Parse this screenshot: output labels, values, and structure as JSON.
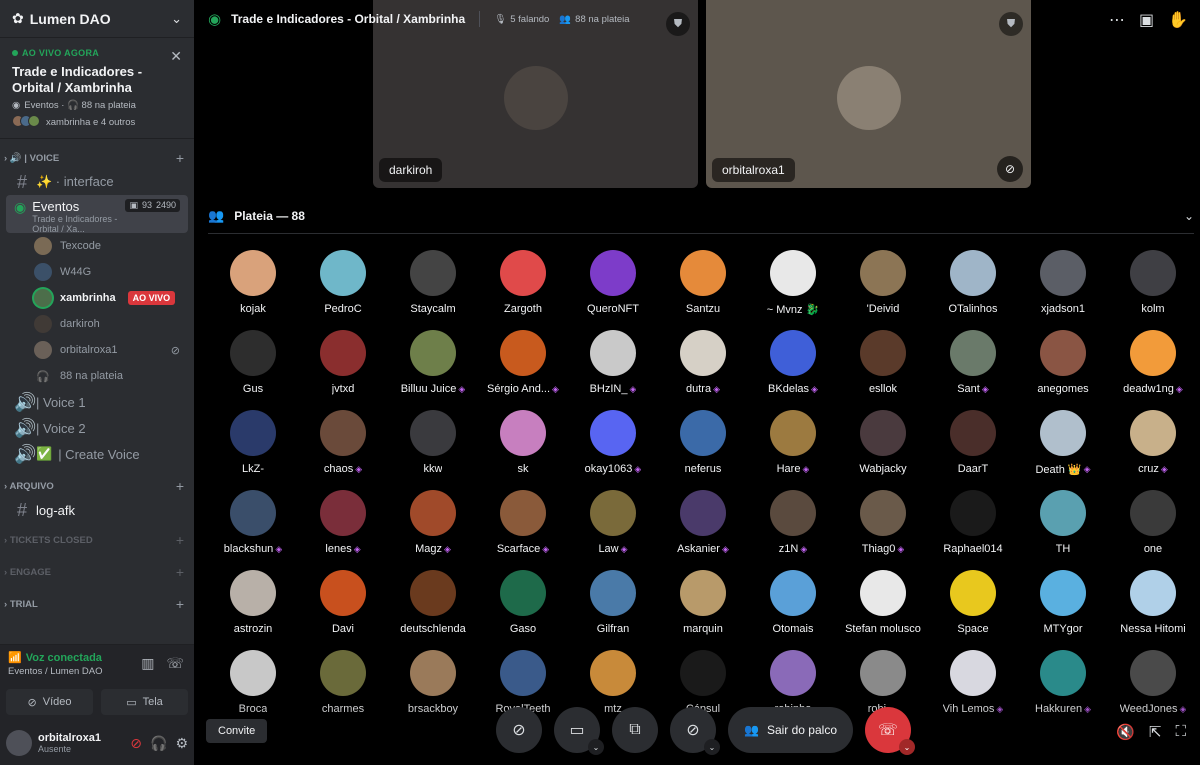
{
  "guild": {
    "name": "Lumen DAO"
  },
  "live": {
    "label": "AO VIVO AGORA",
    "title": "Trade e Indicadores - Orbital / Xambrinha",
    "meta": "Eventos · 🎧 88 na plateia",
    "participants": "xambrinha e 4 outros"
  },
  "sidebar": {
    "cat_voice": "| VOICE",
    "interface": "✨ · interface",
    "eventos": {
      "name": "Eventos",
      "sub": "Trade e Indicadores - Orbital / Xa...",
      "cam": "93",
      "count": "2490"
    },
    "members": [
      {
        "name": "Texcode",
        "color": "#7a6a55"
      },
      {
        "name": "W44G",
        "color": "#3b5068"
      },
      {
        "name": "xambrinha",
        "color": "#4c6e4a",
        "live": "AO VIVO"
      },
      {
        "name": "darkiroh",
        "color": "#403a36"
      },
      {
        "name": "orbitalroxa1",
        "color": "#6a6058"
      },
      {
        "name": "88 na plateia",
        "color": "#2b2d31"
      }
    ],
    "voice1": "| Voice 1",
    "voice2": "| Voice 2",
    "create_voice": "| Create Voice",
    "cat_arquivo": "ARQUIVO",
    "log_afk": "log-afk",
    "cat_tickets": "TICKETS CLOSED",
    "cat_engage": "ENGAGE",
    "cat_trial": "TRIAL"
  },
  "voice_connected": {
    "title": "Voz conectada",
    "sub": "Eventos / Lumen DAO",
    "video": "Vídeo",
    "screen": "Tela"
  },
  "user": {
    "name": "orbitalroxa1",
    "status": "Ausente"
  },
  "topbar": {
    "title": "Trade e Indicadores - Orbital / Xambrinha",
    "speaking": "5 falando",
    "audience": "88 na plateia"
  },
  "stage": [
    {
      "name": "darkiroh",
      "bg": "#353232",
      "av": "#4a4440"
    },
    {
      "name": "orbitalroxa1",
      "bg": "#5d564d",
      "av": "#8a8073"
    }
  ],
  "plateia": {
    "title": "Plateia — 88",
    "members": [
      {
        "n": "kojak",
        "c": "#d9a27b"
      },
      {
        "n": "PedroC",
        "c": "#6fb7c9"
      },
      {
        "n": "Staycalm",
        "c": "#444"
      },
      {
        "n": "Zargoth",
        "c": "#e04a4a"
      },
      {
        "n": "QueroNFT",
        "c": "#7d3cc9"
      },
      {
        "n": "Santzu",
        "c": "#e58a3a"
      },
      {
        "n": "~ Mvnz 🐉",
        "c": "#e8e8e8"
      },
      {
        "n": "'Deivid",
        "c": "#8c7555"
      },
      {
        "n": "OTalinhos",
        "c": "#9fb5c8"
      },
      {
        "n": "xjadson1",
        "c": "#5b5e66"
      },
      {
        "n": "kolm",
        "c": "#3f3f44"
      },
      {
        "n": "Gus",
        "c": "#2d2d2d"
      },
      {
        "n": "jvtxd",
        "c": "#8a2e2e"
      },
      {
        "n": "Billuu Juice",
        "c": "#6e7f4a",
        "g": true
      },
      {
        "n": "Sérgio And...",
        "c": "#c85a1e",
        "g": true
      },
      {
        "n": "BHzIN_",
        "c": "#c9c9c9",
        "g": true
      },
      {
        "n": "dutra",
        "c": "#d6d0c6",
        "g": true
      },
      {
        "n": "BKdelas",
        "c": "#3f5fd8",
        "g": true
      },
      {
        "n": "esllok",
        "c": "#5a3a2a"
      },
      {
        "n": "Sant",
        "c": "#6a7a6a",
        "g": true
      },
      {
        "n": "anegomes",
        "c": "#8a5544"
      },
      {
        "n": "deadw1ng",
        "c": "#f29b3a",
        "g": true
      },
      {
        "n": "LkZ-",
        "c": "#2a3a6a"
      },
      {
        "n": "chaos",
        "c": "#6a4a3a",
        "g": true
      },
      {
        "n": "kkw",
        "c": "#3a3a3e"
      },
      {
        "n": "sk",
        "c": "#c77fbf"
      },
      {
        "n": "okay1063",
        "c": "#5865f2",
        "g": true
      },
      {
        "n": "neferus",
        "c": "#3b6aa8"
      },
      {
        "n": "Hare",
        "c": "#9c7a40",
        "g": true
      },
      {
        "n": "Wabjacky",
        "c": "#4a3a3e"
      },
      {
        "n": "DaarT",
        "c": "#4a2e2a"
      },
      {
        "n": "Death 👑",
        "c": "#b0bfcc",
        "g": true
      },
      {
        "n": "cruz",
        "c": "#c8b08a",
        "g": true
      },
      {
        "n": "blackshun",
        "c": "#3a4e6a",
        "g": true
      },
      {
        "n": "lenes",
        "c": "#7a2e3a",
        "g": true
      },
      {
        "n": "Magz",
        "c": "#a04a2a",
        "g": true
      },
      {
        "n": "Scarface",
        "c": "#8a5a3a",
        "g": true
      },
      {
        "n": "Law",
        "c": "#7a6a3a",
        "g": true
      },
      {
        "n": "Askanier",
        "c": "#4a3a6a",
        "g": true
      },
      {
        "n": "z1N",
        "c": "#5a4a3e",
        "g": true
      },
      {
        "n": "Thiag0",
        "c": "#6a5a4a",
        "g": true
      },
      {
        "n": "Raphael014",
        "c": "#1a1a1a"
      },
      {
        "n": "TH",
        "c": "#5aa0b0"
      },
      {
        "n": "one",
        "c": "#3a3a3a"
      },
      {
        "n": "astrozin",
        "c": "#b8b0a8"
      },
      {
        "n": "Davi",
        "c": "#c8501e"
      },
      {
        "n": "deutschlenda",
        "c": "#6a3a1e"
      },
      {
        "n": "Gaso",
        "c": "#1e6a4a"
      },
      {
        "n": "Gilfran",
        "c": "#4a7aa8"
      },
      {
        "n": "marquin",
        "c": "#b89a6a"
      },
      {
        "n": "Otomais",
        "c": "#5aa0d8"
      },
      {
        "n": "Stefan molusco",
        "c": "#e8e8e8"
      },
      {
        "n": "Space",
        "c": "#e8c81e"
      },
      {
        "n": "MTYgor",
        "c": "#5ab0e0"
      },
      {
        "n": "Nessa Hitomi",
        "c": "#b0d0e8"
      },
      {
        "n": "Broca",
        "c": "#c8c8c8"
      },
      {
        "n": "charmes",
        "c": "#6a6a3a"
      },
      {
        "n": "brsackboy",
        "c": "#9a7a5a"
      },
      {
        "n": "RoyalTeeth",
        "c": "#3a5a8a"
      },
      {
        "n": "mtz",
        "c": "#c88a3a"
      },
      {
        "n": "Cápsul",
        "c": "#1a1a1a"
      },
      {
        "n": "robinho",
        "c": "#8a6ab8"
      },
      {
        "n": "robi....",
        "c": "#8a8a8a"
      },
      {
        "n": "Vih Lemos",
        "c": "#d8d8e0",
        "g": true
      },
      {
        "n": "Hakkuren",
        "c": "#2a8a8a",
        "g": true
      },
      {
        "n": "WeedJones",
        "c": "#4a4a4a",
        "g": true
      }
    ]
  },
  "controls": {
    "leave_stage": "Sair do palco",
    "invite": "Convite"
  }
}
